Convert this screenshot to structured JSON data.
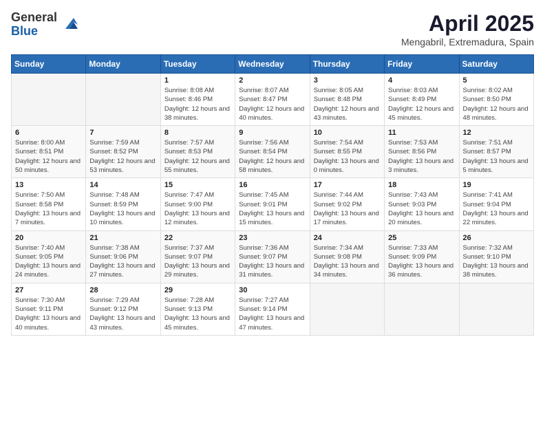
{
  "header": {
    "logo": {
      "general": "General",
      "blue": "Blue"
    },
    "title": "April 2025",
    "location": "Mengabril, Extremadura, Spain"
  },
  "calendar": {
    "headers": [
      "Sunday",
      "Monday",
      "Tuesday",
      "Wednesday",
      "Thursday",
      "Friday",
      "Saturday"
    ],
    "weeks": [
      [
        {
          "day": "",
          "info": ""
        },
        {
          "day": "",
          "info": ""
        },
        {
          "day": "1",
          "sunrise": "8:08 AM",
          "sunset": "8:46 PM",
          "daylight": "12 hours and 38 minutes."
        },
        {
          "day": "2",
          "sunrise": "8:07 AM",
          "sunset": "8:47 PM",
          "daylight": "12 hours and 40 minutes."
        },
        {
          "day": "3",
          "sunrise": "8:05 AM",
          "sunset": "8:48 PM",
          "daylight": "12 hours and 43 minutes."
        },
        {
          "day": "4",
          "sunrise": "8:03 AM",
          "sunset": "8:49 PM",
          "daylight": "12 hours and 45 minutes."
        },
        {
          "day": "5",
          "sunrise": "8:02 AM",
          "sunset": "8:50 PM",
          "daylight": "12 hours and 48 minutes."
        }
      ],
      [
        {
          "day": "6",
          "sunrise": "8:00 AM",
          "sunset": "8:51 PM",
          "daylight": "12 hours and 50 minutes."
        },
        {
          "day": "7",
          "sunrise": "7:59 AM",
          "sunset": "8:52 PM",
          "daylight": "12 hours and 53 minutes."
        },
        {
          "day": "8",
          "sunrise": "7:57 AM",
          "sunset": "8:53 PM",
          "daylight": "12 hours and 55 minutes."
        },
        {
          "day": "9",
          "sunrise": "7:56 AM",
          "sunset": "8:54 PM",
          "daylight": "12 hours and 58 minutes."
        },
        {
          "day": "10",
          "sunrise": "7:54 AM",
          "sunset": "8:55 PM",
          "daylight": "13 hours and 0 minutes."
        },
        {
          "day": "11",
          "sunrise": "7:53 AM",
          "sunset": "8:56 PM",
          "daylight": "13 hours and 3 minutes."
        },
        {
          "day": "12",
          "sunrise": "7:51 AM",
          "sunset": "8:57 PM",
          "daylight": "13 hours and 5 minutes."
        }
      ],
      [
        {
          "day": "13",
          "sunrise": "7:50 AM",
          "sunset": "8:58 PM",
          "daylight": "13 hours and 7 minutes."
        },
        {
          "day": "14",
          "sunrise": "7:48 AM",
          "sunset": "8:59 PM",
          "daylight": "13 hours and 10 minutes."
        },
        {
          "day": "15",
          "sunrise": "7:47 AM",
          "sunset": "9:00 PM",
          "daylight": "13 hours and 12 minutes."
        },
        {
          "day": "16",
          "sunrise": "7:45 AM",
          "sunset": "9:01 PM",
          "daylight": "13 hours and 15 minutes."
        },
        {
          "day": "17",
          "sunrise": "7:44 AM",
          "sunset": "9:02 PM",
          "daylight": "13 hours and 17 minutes."
        },
        {
          "day": "18",
          "sunrise": "7:43 AM",
          "sunset": "9:03 PM",
          "daylight": "13 hours and 20 minutes."
        },
        {
          "day": "19",
          "sunrise": "7:41 AM",
          "sunset": "9:04 PM",
          "daylight": "13 hours and 22 minutes."
        }
      ],
      [
        {
          "day": "20",
          "sunrise": "7:40 AM",
          "sunset": "9:05 PM",
          "daylight": "13 hours and 24 minutes."
        },
        {
          "day": "21",
          "sunrise": "7:38 AM",
          "sunset": "9:06 PM",
          "daylight": "13 hours and 27 minutes."
        },
        {
          "day": "22",
          "sunrise": "7:37 AM",
          "sunset": "9:07 PM",
          "daylight": "13 hours and 29 minutes."
        },
        {
          "day": "23",
          "sunrise": "7:36 AM",
          "sunset": "9:07 PM",
          "daylight": "13 hours and 31 minutes."
        },
        {
          "day": "24",
          "sunrise": "7:34 AM",
          "sunset": "9:08 PM",
          "daylight": "13 hours and 34 minutes."
        },
        {
          "day": "25",
          "sunrise": "7:33 AM",
          "sunset": "9:09 PM",
          "daylight": "13 hours and 36 minutes."
        },
        {
          "day": "26",
          "sunrise": "7:32 AM",
          "sunset": "9:10 PM",
          "daylight": "13 hours and 38 minutes."
        }
      ],
      [
        {
          "day": "27",
          "sunrise": "7:30 AM",
          "sunset": "9:11 PM",
          "daylight": "13 hours and 40 minutes."
        },
        {
          "day": "28",
          "sunrise": "7:29 AM",
          "sunset": "9:12 PM",
          "daylight": "13 hours and 43 minutes."
        },
        {
          "day": "29",
          "sunrise": "7:28 AM",
          "sunset": "9:13 PM",
          "daylight": "13 hours and 45 minutes."
        },
        {
          "day": "30",
          "sunrise": "7:27 AM",
          "sunset": "9:14 PM",
          "daylight": "13 hours and 47 minutes."
        },
        {
          "day": "",
          "info": ""
        },
        {
          "day": "",
          "info": ""
        },
        {
          "day": "",
          "info": ""
        }
      ]
    ]
  }
}
